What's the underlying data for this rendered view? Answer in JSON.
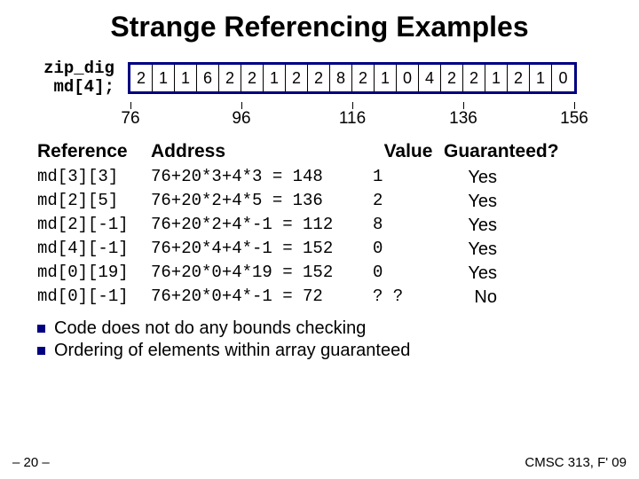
{
  "title": "Strange Referencing Examples",
  "decl_line1": "zip_dig",
  "decl_line2": " md[4];",
  "cells": [
    "2",
    "1",
    "1",
    "6",
    "2",
    "2",
    "1",
    "2",
    "2",
    "8",
    "2",
    "1",
    "0",
    "4",
    "2",
    "2",
    "1",
    "2",
    "1",
    "0"
  ],
  "addresses": [
    "76",
    "96",
    "116",
    "136",
    "156"
  ],
  "hdr_ref": "Reference",
  "hdr_addr": "Address",
  "hdr_val": "Value",
  "hdr_g": "Guaranteed?",
  "rows": [
    {
      "ref": "md[3][3]",
      "addr": "76+20*3+4*3 = 148",
      "val": "1",
      "g": "Yes"
    },
    {
      "ref": "md[2][5]",
      "addr": "76+20*2+4*5 = 136",
      "val": "2",
      "g": "Yes"
    },
    {
      "ref": "md[2][-1]",
      "addr": "76+20*2+4*-1 = 112",
      "val": "8",
      "g": "Yes"
    },
    {
      "ref": "md[4][-1]",
      "addr": "76+20*4+4*-1 = 152",
      "val": "0",
      "g": "Yes"
    },
    {
      "ref": "md[0][19]",
      "addr": "76+20*0+4*19 = 152",
      "val": "0",
      "g": "Yes"
    },
    {
      "ref": "md[0][-1]",
      "addr": "76+20*0+4*-1 = 72",
      "val": "? ?",
      "g": "No"
    }
  ],
  "bullet1": "Code does not do any bounds checking",
  "bullet2": "Ordering of elements within array guaranteed",
  "footer_left": "– 20 –",
  "footer_right": "CMSC 313, F' 09"
}
